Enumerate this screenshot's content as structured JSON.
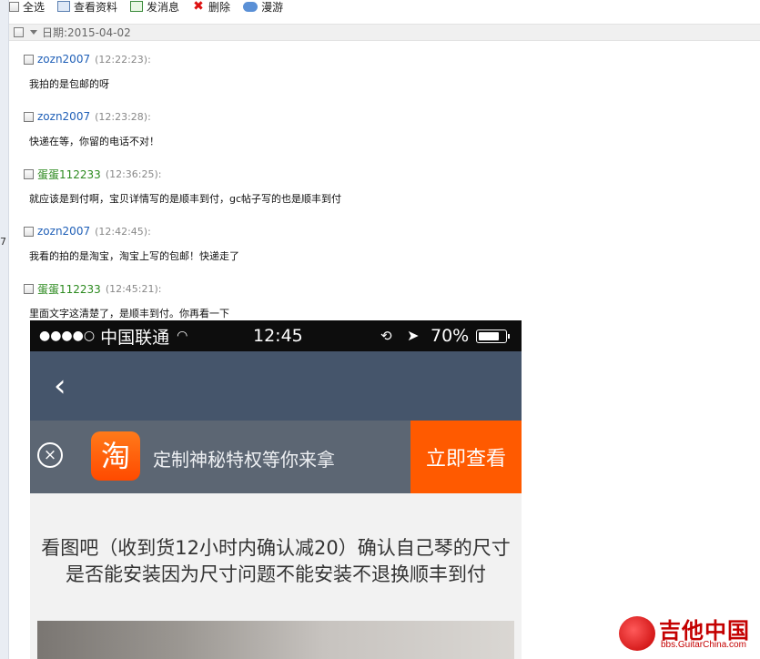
{
  "toolbar": {
    "select_all": "全选",
    "view_profile": "查看资料",
    "send_message": "发消息",
    "delete": "删除",
    "roam": "漫游"
  },
  "date_group": {
    "label": "日期:2015-04-02"
  },
  "left_strip": {
    "marker": "7"
  },
  "messages": [
    {
      "sender": "zozn2007",
      "time": "(12:22:23):",
      "text": "我拍的是包邮的呀"
    },
    {
      "sender": "zozn2007",
      "time": "(12:23:28):",
      "text": "快递在等，你留的电话不对！"
    },
    {
      "sender": "蛋蛋112233",
      "time": "(12:36:25):",
      "text": "就应该是到付啊，宝贝详情写的是顺丰到付，gc帖子写的也是顺丰到付"
    },
    {
      "sender": "zozn2007",
      "time": "(12:42:45):",
      "text": "我看的拍的是淘宝，淘宝上写的包邮！快递走了"
    },
    {
      "sender": "蛋蛋112233",
      "time": "(12:45:21):",
      "text": "里面文字这清楚了，是顺丰到付。你再看一下"
    }
  ],
  "screenshot": {
    "signal": "●●●●○",
    "carrier": "中国联通",
    "wifi_icon": "wifi-icon",
    "clock": "12:45",
    "battery_pct": "70%",
    "back_icon": "‹",
    "close_icon": "×",
    "taobao_char": "淘",
    "promo_text": "定制神秘特权等你来拿",
    "cta": "立即查看",
    "description": "看图吧（收到货12小时内确认减20）确认自己琴的尺寸是否能安装因为尺寸问题不能安装不退换顺丰到付"
  },
  "watermark": {
    "title": "吉他中国",
    "url": "bbs.GuitarChina.com"
  }
}
